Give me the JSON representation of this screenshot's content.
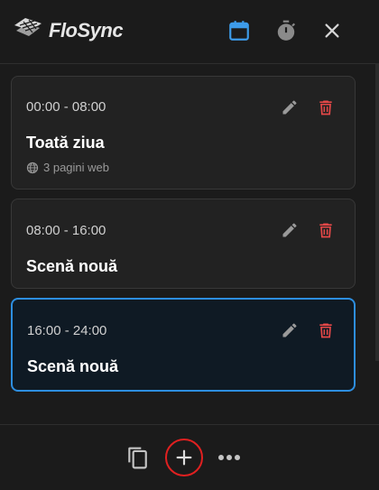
{
  "header": {
    "app_name": "FloSync",
    "icons": [
      "logo-icon",
      "calendar-icon",
      "timer-icon",
      "close-icon"
    ],
    "calendar_color": "#3d9be9"
  },
  "scenes": [
    {
      "time": "00:00 - 08:00",
      "title": "Toată ziua",
      "subtitle": "3 pagini web",
      "active": false
    },
    {
      "time": "08:00 - 16:00",
      "title": "Scenă nouă",
      "active": false
    },
    {
      "time": "16:00 - 24:00",
      "title": "Scenă nouă",
      "active": true
    }
  ],
  "footer": {
    "icons": [
      "copy-icon",
      "add-icon",
      "more-icon"
    ],
    "add_highlight_color": "#e02020"
  },
  "colors": {
    "accent": "#2d8ee0",
    "delete": "#e54848"
  }
}
